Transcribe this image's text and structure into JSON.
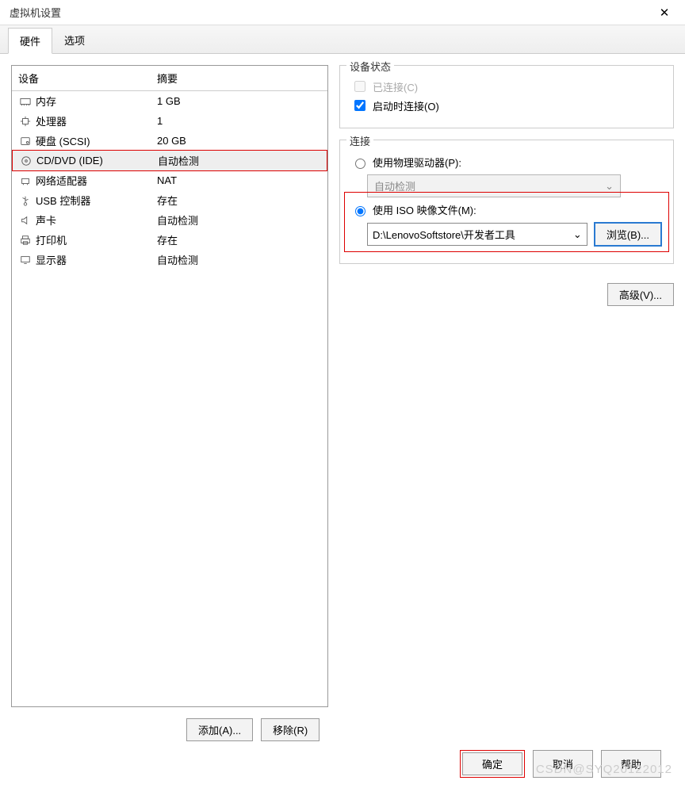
{
  "window": {
    "title": "虚拟机设置",
    "close": "✕"
  },
  "tabs": {
    "hardware": "硬件",
    "options": "选项"
  },
  "columns": {
    "device": "设备",
    "summary": "摘要"
  },
  "devices": [
    {
      "icon": "memory",
      "name": "内存",
      "summary": "1 GB"
    },
    {
      "icon": "cpu",
      "name": "处理器",
      "summary": "1"
    },
    {
      "icon": "disk",
      "name": "硬盘 (SCSI)",
      "summary": "20 GB"
    },
    {
      "icon": "cd",
      "name": "CD/DVD (IDE)",
      "summary": "自动检测"
    },
    {
      "icon": "net",
      "name": "网络适配器",
      "summary": "NAT"
    },
    {
      "icon": "usb",
      "name": "USB 控制器",
      "summary": "存在"
    },
    {
      "icon": "sound",
      "name": "声卡",
      "summary": "自动检测"
    },
    {
      "icon": "printer",
      "name": "打印机",
      "summary": "存在"
    },
    {
      "icon": "display",
      "name": "显示器",
      "summary": "自动检测"
    }
  ],
  "status": {
    "legend": "设备状态",
    "connected": "已连接(C)",
    "connect_on": "启动时连接(O)"
  },
  "connection": {
    "legend": "连接",
    "use_physical": "使用物理驱动器(P):",
    "autodetect": "自动检测",
    "use_iso": "使用 ISO 映像文件(M):",
    "iso_path": "D:\\LenovoSoftstore\\开发者工具",
    "browse": "浏览(B)..."
  },
  "buttons": {
    "advanced": "高级(V)...",
    "add": "添加(A)...",
    "remove": "移除(R)",
    "ok": "确定",
    "cancel": "取消",
    "help": "帮助"
  },
  "watermark": "CSDN@SYQ20122012"
}
